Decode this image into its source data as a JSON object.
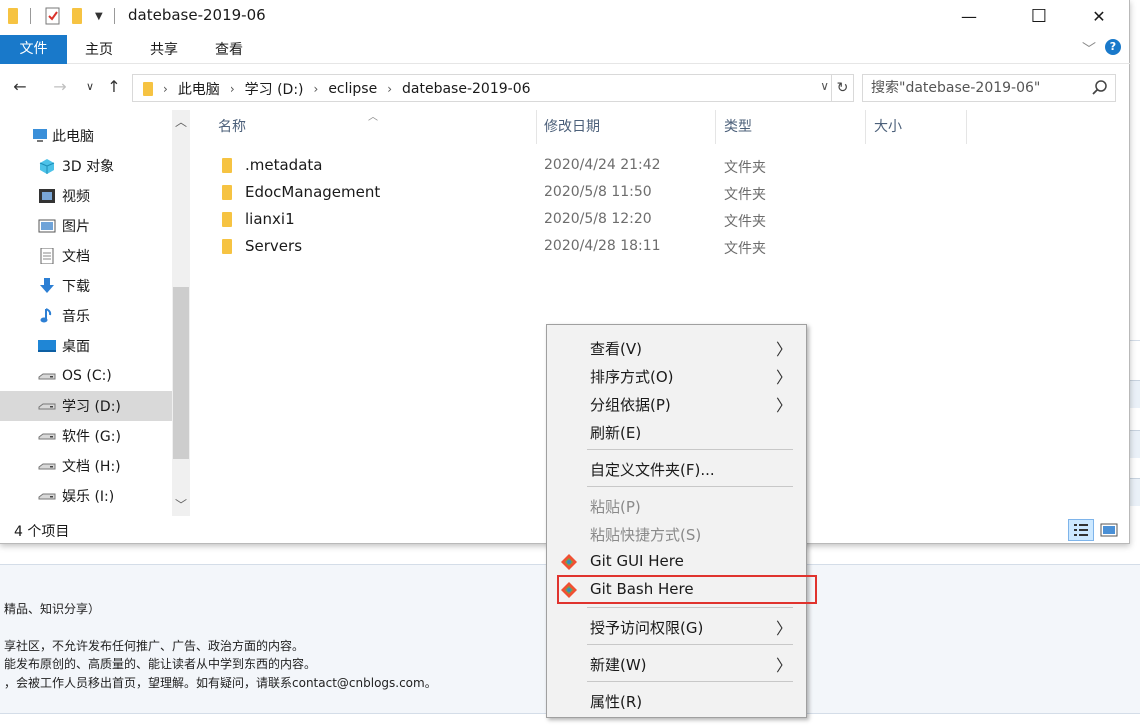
{
  "window": {
    "title": "datebase-2019-06",
    "controls": {
      "minimize": "—",
      "maximize": "☐",
      "close": "✕"
    }
  },
  "ribbon": {
    "tabs": [
      {
        "label": "文件",
        "active": true
      },
      {
        "label": "主页"
      },
      {
        "label": "共享"
      },
      {
        "label": "查看"
      }
    ]
  },
  "address": {
    "crumbs": [
      "此电脑",
      "学习 (D:)",
      "eclipse",
      "datebase-2019-06"
    ],
    "search_placeholder": "搜索\"datebase-2019-06\""
  },
  "nav": {
    "items": [
      {
        "label": "此电脑",
        "icon": "computer-icon"
      },
      {
        "label": "3D 对象",
        "icon": "3d-objects-icon"
      },
      {
        "label": "视频",
        "icon": "video-icon"
      },
      {
        "label": "图片",
        "icon": "pictures-icon"
      },
      {
        "label": "文档",
        "icon": "documents-icon"
      },
      {
        "label": "下载",
        "icon": "download-icon"
      },
      {
        "label": "音乐",
        "icon": "music-icon"
      },
      {
        "label": "桌面",
        "icon": "desktop-icon"
      },
      {
        "label": "OS (C:)",
        "icon": "drive-icon"
      },
      {
        "label": "学习 (D:)",
        "icon": "drive-icon",
        "selected": true
      },
      {
        "label": "软件 (G:)",
        "icon": "drive-icon"
      },
      {
        "label": "文档 (H:)",
        "icon": "drive-icon"
      },
      {
        "label": "娱乐 (I:)",
        "icon": "drive-icon"
      }
    ]
  },
  "filelist": {
    "columns": [
      "名称",
      "修改日期",
      "类型",
      "大小"
    ],
    "rows": [
      {
        "name": ".metadata",
        "modified": "2020/4/24 21:42",
        "type": "文件夹"
      },
      {
        "name": "EdocManagement",
        "modified": "2020/5/8 11:50",
        "type": "文件夹"
      },
      {
        "name": "lianxi1",
        "modified": "2020/5/8 12:20",
        "type": "文件夹"
      },
      {
        "name": "Servers",
        "modified": "2020/4/28 18:11",
        "type": "文件夹"
      }
    ]
  },
  "status": {
    "text": "4 个项目"
  },
  "context_menu": {
    "items": [
      {
        "label": "查看(V)",
        "submenu": true
      },
      {
        "label": "排序方式(O)",
        "submenu": true
      },
      {
        "label": "分组依据(P)",
        "submenu": true
      },
      {
        "label": "刷新(E)"
      },
      {
        "label": "自定义文件夹(F)..."
      },
      {
        "label": "粘贴(P)",
        "disabled": true
      },
      {
        "label": "粘贴快捷方式(S)",
        "disabled": true
      },
      {
        "label": "Git GUI Here",
        "icon": "git-icon"
      },
      {
        "label": "Git Bash Here",
        "icon": "git-icon",
        "highlighted": true
      },
      {
        "label": "授予访问权限(G)",
        "submenu": true
      },
      {
        "label": "新建(W)",
        "submenu": true
      },
      {
        "label": "属性(R)"
      }
    ]
  },
  "background_page": {
    "lines": [
      "精品、知识分享）",
      "享社区，不允许发布任何推广、广告、政治方面的内容。",
      "能发布原创的、高质量的、能让读者从中学到东西的内容。",
      "，会被工作人员移出首页，望理解。如有疑问，请联系contact@cnblogs.com。"
    ]
  },
  "colors": {
    "accent": "#1979ca",
    "highlight_box": "#e0332e",
    "folder": "#f6c342"
  }
}
